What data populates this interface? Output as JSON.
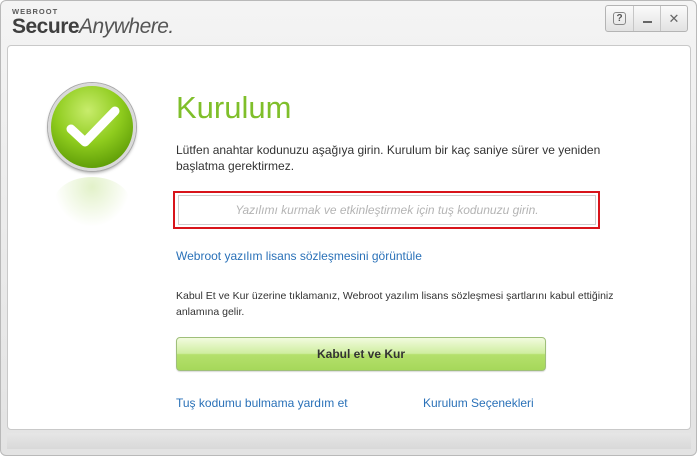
{
  "app": {
    "brand_small": "WEBROOT",
    "brand_bold": "Secure",
    "brand_italic": "Anywhere."
  },
  "window_controls": {
    "help": "?",
    "close": "✕"
  },
  "page": {
    "title": "Kurulum",
    "description": "Lütfen anahtar kodunuzu aşağıya girin. Kurulum bir kaç saniye sürer ve yeniden başlatma gerektirmez.",
    "keycode_placeholder": "Yazılımı kurmak ve etkinleştirmek için tuş kodunuzu girin.",
    "keycode_value": "",
    "eula_link": "Webroot yazılım lisans sözleşmesini görüntüle",
    "agree_text": "Kabul Et ve Kur üzerine tıklamanız, Webroot yazılım lisans sözleşmesi şartlarını kabul ettiğiniz anlamına gelir.",
    "install_button": "Kabul et ve Kur",
    "help_link": "Tuş kodumu bulmama yardım et",
    "options_link": "Kurulum Seçenekleri"
  },
  "colors": {
    "title_green": "#7fbf2a",
    "link_blue": "#2a71b8",
    "highlight_red": "#d8141b"
  },
  "icons": {
    "status": "checkmark-circle-icon"
  }
}
